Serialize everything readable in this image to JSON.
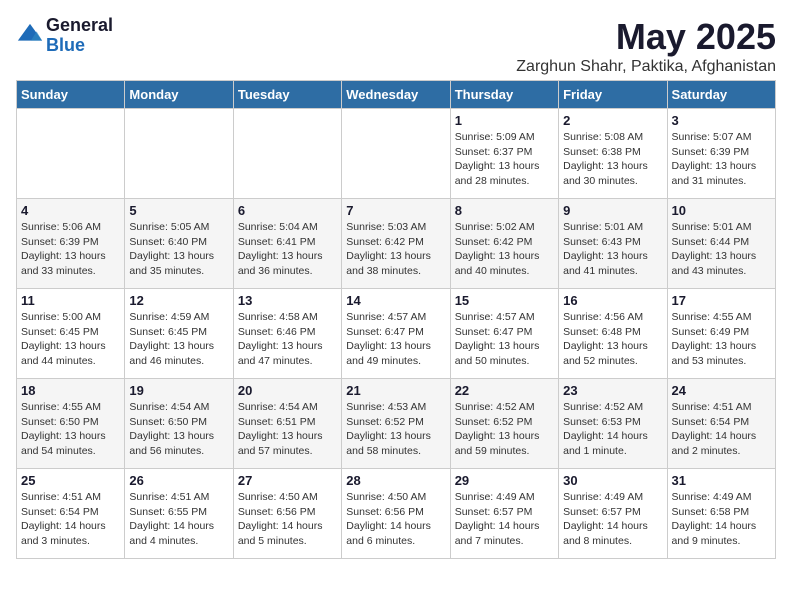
{
  "logo": {
    "general": "General",
    "blue": "Blue"
  },
  "title": "May 2025",
  "subtitle": "Zarghun Shahr, Paktika, Afghanistan",
  "weekdays": [
    "Sunday",
    "Monday",
    "Tuesday",
    "Wednesday",
    "Thursday",
    "Friday",
    "Saturday"
  ],
  "weeks": [
    [
      {
        "day": "",
        "info": ""
      },
      {
        "day": "",
        "info": ""
      },
      {
        "day": "",
        "info": ""
      },
      {
        "day": "",
        "info": ""
      },
      {
        "day": "1",
        "info": "Sunrise: 5:09 AM\nSunset: 6:37 PM\nDaylight: 13 hours\nand 28 minutes."
      },
      {
        "day": "2",
        "info": "Sunrise: 5:08 AM\nSunset: 6:38 PM\nDaylight: 13 hours\nand 30 minutes."
      },
      {
        "day": "3",
        "info": "Sunrise: 5:07 AM\nSunset: 6:39 PM\nDaylight: 13 hours\nand 31 minutes."
      }
    ],
    [
      {
        "day": "4",
        "info": "Sunrise: 5:06 AM\nSunset: 6:39 PM\nDaylight: 13 hours\nand 33 minutes."
      },
      {
        "day": "5",
        "info": "Sunrise: 5:05 AM\nSunset: 6:40 PM\nDaylight: 13 hours\nand 35 minutes."
      },
      {
        "day": "6",
        "info": "Sunrise: 5:04 AM\nSunset: 6:41 PM\nDaylight: 13 hours\nand 36 minutes."
      },
      {
        "day": "7",
        "info": "Sunrise: 5:03 AM\nSunset: 6:42 PM\nDaylight: 13 hours\nand 38 minutes."
      },
      {
        "day": "8",
        "info": "Sunrise: 5:02 AM\nSunset: 6:42 PM\nDaylight: 13 hours\nand 40 minutes."
      },
      {
        "day": "9",
        "info": "Sunrise: 5:01 AM\nSunset: 6:43 PM\nDaylight: 13 hours\nand 41 minutes."
      },
      {
        "day": "10",
        "info": "Sunrise: 5:01 AM\nSunset: 6:44 PM\nDaylight: 13 hours\nand 43 minutes."
      }
    ],
    [
      {
        "day": "11",
        "info": "Sunrise: 5:00 AM\nSunset: 6:45 PM\nDaylight: 13 hours\nand 44 minutes."
      },
      {
        "day": "12",
        "info": "Sunrise: 4:59 AM\nSunset: 6:45 PM\nDaylight: 13 hours\nand 46 minutes."
      },
      {
        "day": "13",
        "info": "Sunrise: 4:58 AM\nSunset: 6:46 PM\nDaylight: 13 hours\nand 47 minutes."
      },
      {
        "day": "14",
        "info": "Sunrise: 4:57 AM\nSunset: 6:47 PM\nDaylight: 13 hours\nand 49 minutes."
      },
      {
        "day": "15",
        "info": "Sunrise: 4:57 AM\nSunset: 6:47 PM\nDaylight: 13 hours\nand 50 minutes."
      },
      {
        "day": "16",
        "info": "Sunrise: 4:56 AM\nSunset: 6:48 PM\nDaylight: 13 hours\nand 52 minutes."
      },
      {
        "day": "17",
        "info": "Sunrise: 4:55 AM\nSunset: 6:49 PM\nDaylight: 13 hours\nand 53 minutes."
      }
    ],
    [
      {
        "day": "18",
        "info": "Sunrise: 4:55 AM\nSunset: 6:50 PM\nDaylight: 13 hours\nand 54 minutes."
      },
      {
        "day": "19",
        "info": "Sunrise: 4:54 AM\nSunset: 6:50 PM\nDaylight: 13 hours\nand 56 minutes."
      },
      {
        "day": "20",
        "info": "Sunrise: 4:54 AM\nSunset: 6:51 PM\nDaylight: 13 hours\nand 57 minutes."
      },
      {
        "day": "21",
        "info": "Sunrise: 4:53 AM\nSunset: 6:52 PM\nDaylight: 13 hours\nand 58 minutes."
      },
      {
        "day": "22",
        "info": "Sunrise: 4:52 AM\nSunset: 6:52 PM\nDaylight: 13 hours\nand 59 minutes."
      },
      {
        "day": "23",
        "info": "Sunrise: 4:52 AM\nSunset: 6:53 PM\nDaylight: 14 hours\nand 1 minute."
      },
      {
        "day": "24",
        "info": "Sunrise: 4:51 AM\nSunset: 6:54 PM\nDaylight: 14 hours\nand 2 minutes."
      }
    ],
    [
      {
        "day": "25",
        "info": "Sunrise: 4:51 AM\nSunset: 6:54 PM\nDaylight: 14 hours\nand 3 minutes."
      },
      {
        "day": "26",
        "info": "Sunrise: 4:51 AM\nSunset: 6:55 PM\nDaylight: 14 hours\nand 4 minutes."
      },
      {
        "day": "27",
        "info": "Sunrise: 4:50 AM\nSunset: 6:56 PM\nDaylight: 14 hours\nand 5 minutes."
      },
      {
        "day": "28",
        "info": "Sunrise: 4:50 AM\nSunset: 6:56 PM\nDaylight: 14 hours\nand 6 minutes."
      },
      {
        "day": "29",
        "info": "Sunrise: 4:49 AM\nSunset: 6:57 PM\nDaylight: 14 hours\nand 7 minutes."
      },
      {
        "day": "30",
        "info": "Sunrise: 4:49 AM\nSunset: 6:57 PM\nDaylight: 14 hours\nand 8 minutes."
      },
      {
        "day": "31",
        "info": "Sunrise: 4:49 AM\nSunset: 6:58 PM\nDaylight: 14 hours\nand 9 minutes."
      }
    ]
  ]
}
